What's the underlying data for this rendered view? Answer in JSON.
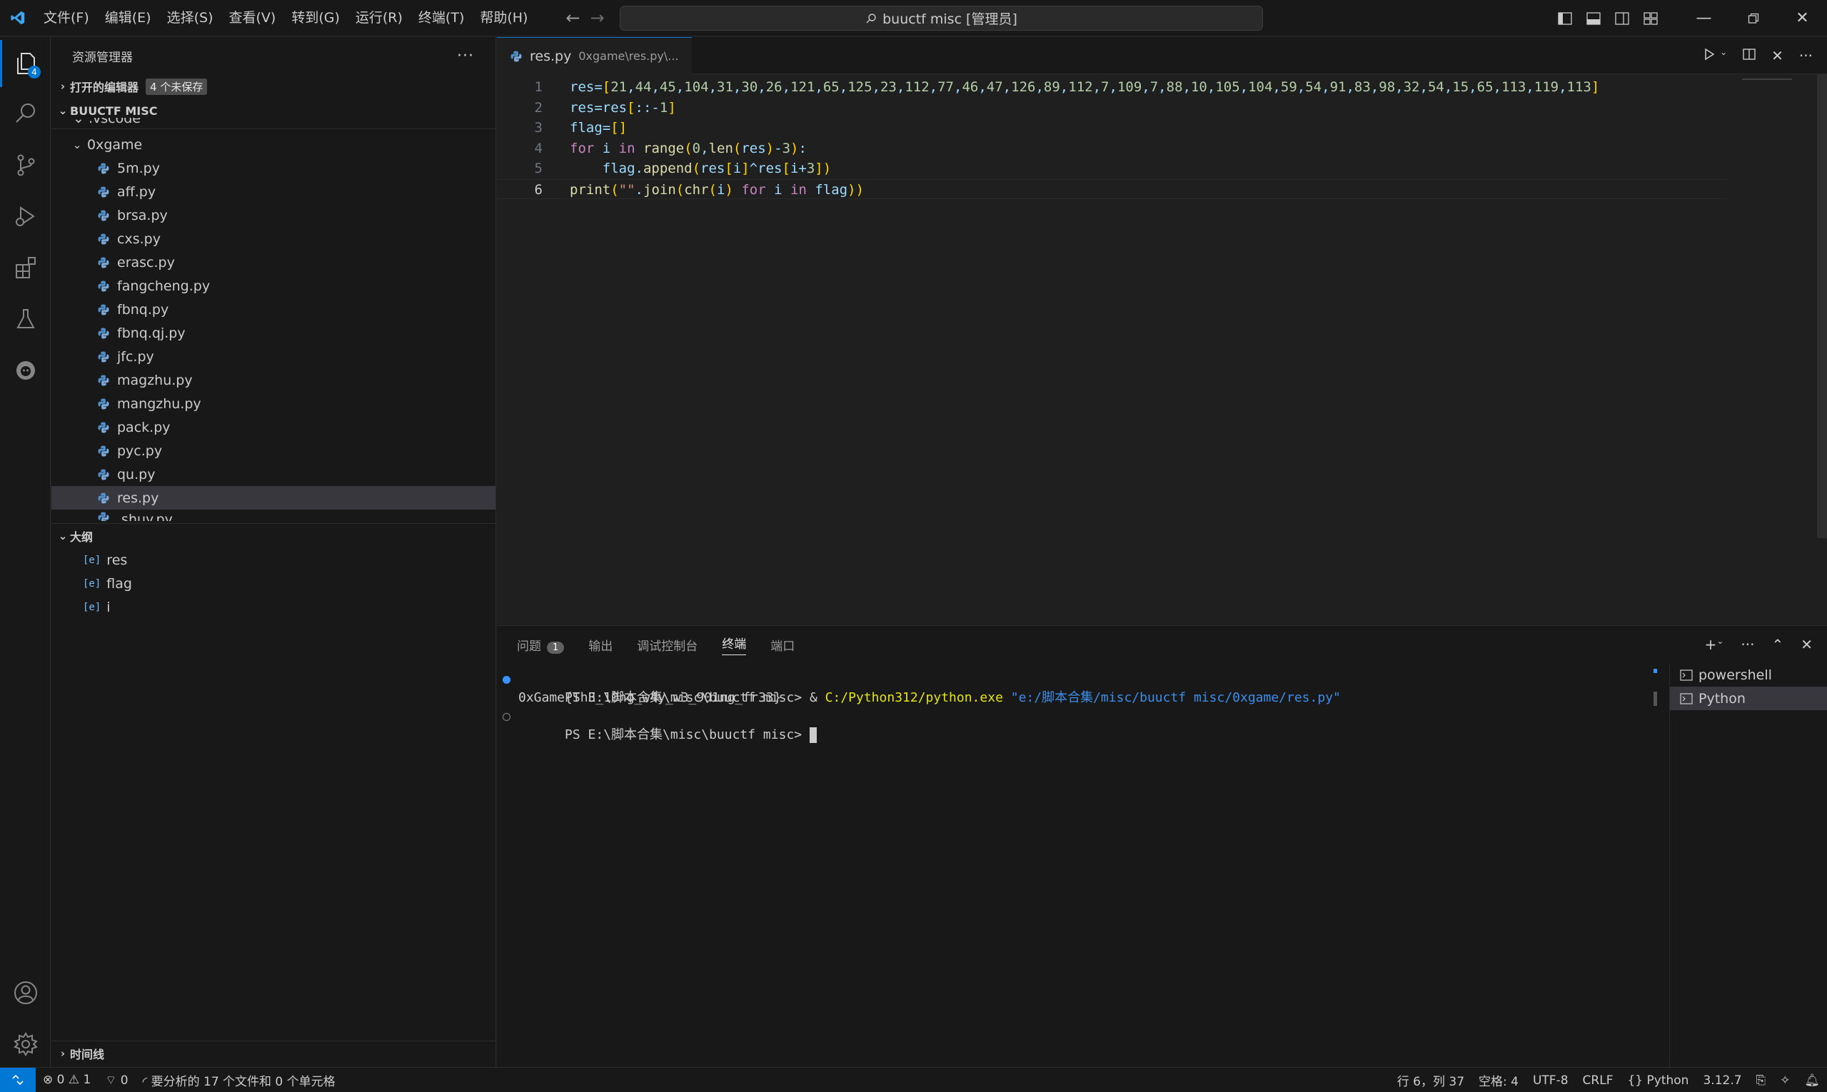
{
  "titlebar": {
    "menus": [
      "文件(F)",
      "编辑(E)",
      "选择(S)",
      "查看(V)",
      "转到(G)",
      "运行(R)",
      "终端(T)",
      "帮助(H)"
    ],
    "search_text": "buuctf misc [管理员]"
  },
  "activity": {
    "explorer_badge": "4"
  },
  "sidebar": {
    "title": "资源管理器",
    "open_editors_label": "打开的编辑器",
    "unsaved_label": "4 个未保存",
    "workspace_label": "BUUCTF MISC",
    "partial_top": ".vscode",
    "folder": "0xgame",
    "files": [
      "5m.py",
      "aff.py",
      "brsa.py",
      "cxs.py",
      "erasc.py",
      "fangcheng.py",
      "fbnq.py",
      "fbnq.qj.py",
      "jfc.py",
      "magzhu.py",
      "mangzhu.py",
      "pack.py",
      "pyc.py",
      "qu.py",
      "res.py"
    ],
    "partial_bottom": "shuy.py",
    "outline_label": "大纲",
    "outline_items": [
      "res",
      "flag",
      "i"
    ],
    "timeline_label": "时间线"
  },
  "editor": {
    "tab_name": "res.py",
    "tab_path": "0xgame\\res.py\\...",
    "lines": [
      {
        "n": "1",
        "text": "res=[21,44,45,104,31,30,26,121,65,125,23,112,77,46,47,126,89,112,7,109,7,88,10,105,104,59,54,91,83,98,32,54,15,65,113,119,113]"
      },
      {
        "n": "2",
        "text": "res=res[::-1]"
      },
      {
        "n": "3",
        "text": "flag=[]"
      },
      {
        "n": "4",
        "text": "for i in range(0,len(res)-3):"
      },
      {
        "n": "5",
        "text": "    flag.append(res[i]^res[i+3])"
      },
      {
        "n": "6",
        "text": "print(\"\".join(chr(i) for i in flag))"
      }
    ]
  },
  "panel": {
    "tabs": [
      "问题",
      "输出",
      "调试控制台",
      "终端",
      "端口"
    ],
    "problems_count": "1",
    "terminal": {
      "prompt1": "PS E:\\脚本合集\\misc\\buuctf misc> ",
      "amp": "& ",
      "exe": "C:/Python312/python.exe",
      "arg": " \"e:/脚本合集/misc/buuctf misc/0xgame/res.py\"",
      "output": "0xGame{Th3_10ng_w4y_w3_901ng_fr33}",
      "prompt2": "PS E:\\脚本合集\\misc\\buuctf misc> "
    },
    "terminals": [
      "powershell",
      "Python"
    ]
  },
  "statusbar": {
    "errors": "0",
    "warnings": "1",
    "ports": "0",
    "analysis": "要分析的 17 个文件和 0 个单元格",
    "position": "行 6，列 37",
    "spaces": "空格: 4",
    "encoding": "UTF-8",
    "eol": "CRLF",
    "language": "Python",
    "version": "3.12.7"
  },
  "colors": {
    "accent": "#0078d4",
    "background": "#1f1f1f",
    "sidebar": "#181818"
  }
}
